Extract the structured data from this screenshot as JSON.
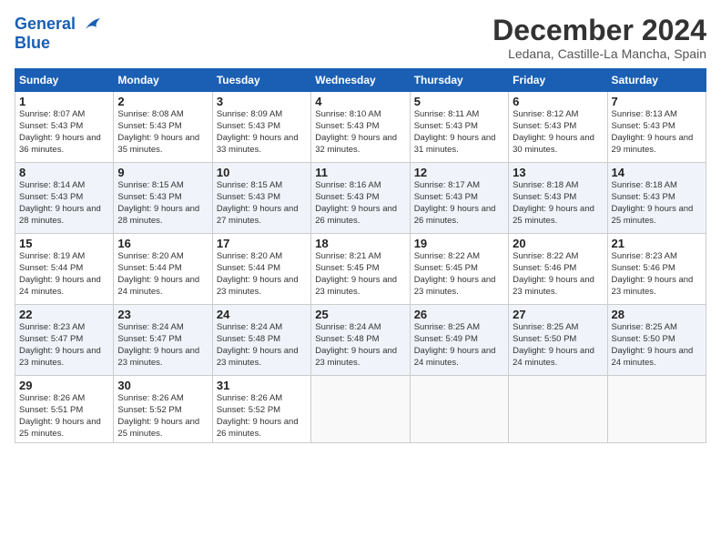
{
  "header": {
    "logo_line1": "General",
    "logo_line2": "Blue",
    "month_title": "December 2024",
    "location": "Ledana, Castille-La Mancha, Spain"
  },
  "days_of_week": [
    "Sunday",
    "Monday",
    "Tuesday",
    "Wednesday",
    "Thursday",
    "Friday",
    "Saturday"
  ],
  "weeks": [
    [
      {
        "day": "1",
        "sunrise": "Sunrise: 8:07 AM",
        "sunset": "Sunset: 5:43 PM",
        "daylight": "Daylight: 9 hours and 36 minutes."
      },
      {
        "day": "2",
        "sunrise": "Sunrise: 8:08 AM",
        "sunset": "Sunset: 5:43 PM",
        "daylight": "Daylight: 9 hours and 35 minutes."
      },
      {
        "day": "3",
        "sunrise": "Sunrise: 8:09 AM",
        "sunset": "Sunset: 5:43 PM",
        "daylight": "Daylight: 9 hours and 33 minutes."
      },
      {
        "day": "4",
        "sunrise": "Sunrise: 8:10 AM",
        "sunset": "Sunset: 5:43 PM",
        "daylight": "Daylight: 9 hours and 32 minutes."
      },
      {
        "day": "5",
        "sunrise": "Sunrise: 8:11 AM",
        "sunset": "Sunset: 5:43 PM",
        "daylight": "Daylight: 9 hours and 31 minutes."
      },
      {
        "day": "6",
        "sunrise": "Sunrise: 8:12 AM",
        "sunset": "Sunset: 5:43 PM",
        "daylight": "Daylight: 9 hours and 30 minutes."
      },
      {
        "day": "7",
        "sunrise": "Sunrise: 8:13 AM",
        "sunset": "Sunset: 5:43 PM",
        "daylight": "Daylight: 9 hours and 29 minutes."
      }
    ],
    [
      {
        "day": "8",
        "sunrise": "Sunrise: 8:14 AM",
        "sunset": "Sunset: 5:43 PM",
        "daylight": "Daylight: 9 hours and 28 minutes."
      },
      {
        "day": "9",
        "sunrise": "Sunrise: 8:15 AM",
        "sunset": "Sunset: 5:43 PM",
        "daylight": "Daylight: 9 hours and 28 minutes."
      },
      {
        "day": "10",
        "sunrise": "Sunrise: 8:15 AM",
        "sunset": "Sunset: 5:43 PM",
        "daylight": "Daylight: 9 hours and 27 minutes."
      },
      {
        "day": "11",
        "sunrise": "Sunrise: 8:16 AM",
        "sunset": "Sunset: 5:43 PM",
        "daylight": "Daylight: 9 hours and 26 minutes."
      },
      {
        "day": "12",
        "sunrise": "Sunrise: 8:17 AM",
        "sunset": "Sunset: 5:43 PM",
        "daylight": "Daylight: 9 hours and 26 minutes."
      },
      {
        "day": "13",
        "sunrise": "Sunrise: 8:18 AM",
        "sunset": "Sunset: 5:43 PM",
        "daylight": "Daylight: 9 hours and 25 minutes."
      },
      {
        "day": "14",
        "sunrise": "Sunrise: 8:18 AM",
        "sunset": "Sunset: 5:43 PM",
        "daylight": "Daylight: 9 hours and 25 minutes."
      }
    ],
    [
      {
        "day": "15",
        "sunrise": "Sunrise: 8:19 AM",
        "sunset": "Sunset: 5:44 PM",
        "daylight": "Daylight: 9 hours and 24 minutes."
      },
      {
        "day": "16",
        "sunrise": "Sunrise: 8:20 AM",
        "sunset": "Sunset: 5:44 PM",
        "daylight": "Daylight: 9 hours and 24 minutes."
      },
      {
        "day": "17",
        "sunrise": "Sunrise: 8:20 AM",
        "sunset": "Sunset: 5:44 PM",
        "daylight": "Daylight: 9 hours and 23 minutes."
      },
      {
        "day": "18",
        "sunrise": "Sunrise: 8:21 AM",
        "sunset": "Sunset: 5:45 PM",
        "daylight": "Daylight: 9 hours and 23 minutes."
      },
      {
        "day": "19",
        "sunrise": "Sunrise: 8:22 AM",
        "sunset": "Sunset: 5:45 PM",
        "daylight": "Daylight: 9 hours and 23 minutes."
      },
      {
        "day": "20",
        "sunrise": "Sunrise: 8:22 AM",
        "sunset": "Sunset: 5:46 PM",
        "daylight": "Daylight: 9 hours and 23 minutes."
      },
      {
        "day": "21",
        "sunrise": "Sunrise: 8:23 AM",
        "sunset": "Sunset: 5:46 PM",
        "daylight": "Daylight: 9 hours and 23 minutes."
      }
    ],
    [
      {
        "day": "22",
        "sunrise": "Sunrise: 8:23 AM",
        "sunset": "Sunset: 5:47 PM",
        "daylight": "Daylight: 9 hours and 23 minutes."
      },
      {
        "day": "23",
        "sunrise": "Sunrise: 8:24 AM",
        "sunset": "Sunset: 5:47 PM",
        "daylight": "Daylight: 9 hours and 23 minutes."
      },
      {
        "day": "24",
        "sunrise": "Sunrise: 8:24 AM",
        "sunset": "Sunset: 5:48 PM",
        "daylight": "Daylight: 9 hours and 23 minutes."
      },
      {
        "day": "25",
        "sunrise": "Sunrise: 8:24 AM",
        "sunset": "Sunset: 5:48 PM",
        "daylight": "Daylight: 9 hours and 23 minutes."
      },
      {
        "day": "26",
        "sunrise": "Sunrise: 8:25 AM",
        "sunset": "Sunset: 5:49 PM",
        "daylight": "Daylight: 9 hours and 24 minutes."
      },
      {
        "day": "27",
        "sunrise": "Sunrise: 8:25 AM",
        "sunset": "Sunset: 5:50 PM",
        "daylight": "Daylight: 9 hours and 24 minutes."
      },
      {
        "day": "28",
        "sunrise": "Sunrise: 8:25 AM",
        "sunset": "Sunset: 5:50 PM",
        "daylight": "Daylight: 9 hours and 24 minutes."
      }
    ],
    [
      {
        "day": "29",
        "sunrise": "Sunrise: 8:26 AM",
        "sunset": "Sunset: 5:51 PM",
        "daylight": "Daylight: 9 hours and 25 minutes."
      },
      {
        "day": "30",
        "sunrise": "Sunrise: 8:26 AM",
        "sunset": "Sunset: 5:52 PM",
        "daylight": "Daylight: 9 hours and 25 minutes."
      },
      {
        "day": "31",
        "sunrise": "Sunrise: 8:26 AM",
        "sunset": "Sunset: 5:52 PM",
        "daylight": "Daylight: 9 hours and 26 minutes."
      },
      null,
      null,
      null,
      null
    ]
  ]
}
